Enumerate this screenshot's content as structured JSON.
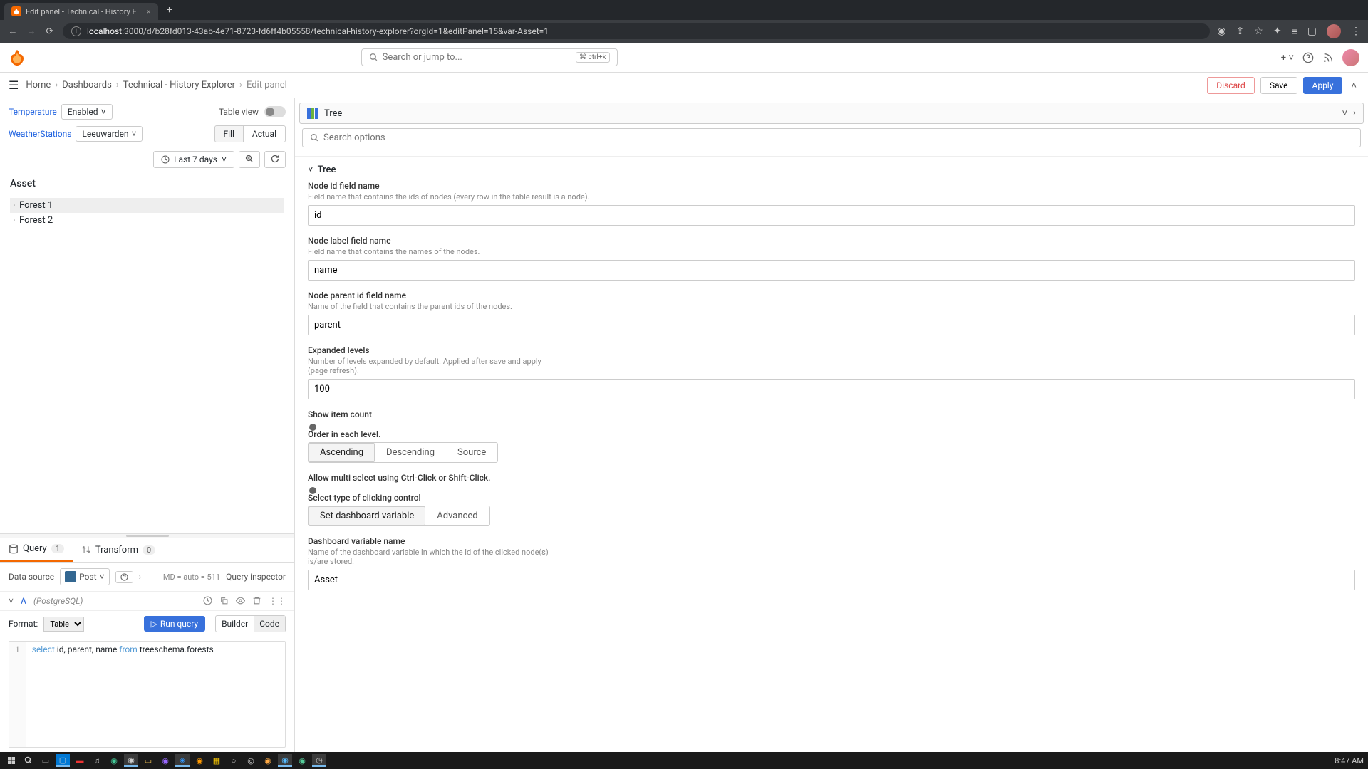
{
  "browser": {
    "tab_title": "Edit panel - Technical - History E",
    "url_host": "localhost",
    "url_path": ":3000/d/b28fd013-43ab-4e71-8723-fd6ff4b05558/technical-history-explorer?orgId=1&editPanel=15&var-Asset=1"
  },
  "search": {
    "placeholder": "Search or jump to...",
    "shortcut_label": "ctrl+k"
  },
  "breadcrumbs": {
    "items": [
      "Home",
      "Dashboards",
      "Technical - History Explorer",
      "Edit panel"
    ]
  },
  "actions": {
    "discard": "Discard",
    "save": "Save",
    "apply": "Apply"
  },
  "vars": {
    "temperature_label": "Temperature",
    "temperature_value": "Enabled",
    "stations_label": "WeatherStations",
    "stations_value": "Leeuwarden",
    "table_view": "Table view",
    "fill": "Fill",
    "actual": "Actual",
    "time_range": "Last 7 days"
  },
  "asset": {
    "title": "Asset",
    "items": [
      "Forest 1",
      "Forest 2"
    ]
  },
  "tabs": {
    "query": "Query",
    "query_count": "1",
    "transform": "Transform",
    "transform_count": "0"
  },
  "datasource": {
    "label": "Data source",
    "value": "Post",
    "md": "MD = auto = 511",
    "inspector": "Query inspector"
  },
  "query": {
    "letter": "A",
    "type": "(PostgreSQL)",
    "format_label": "Format:",
    "format_value": "Table",
    "run": "Run query",
    "builder": "Builder",
    "code": "Code",
    "sql_kw": "select",
    "sql_mid": " id, parent, name ",
    "sql_from": "from",
    "sql_tail": " treeschema.forests"
  },
  "viz": {
    "name": "Tree",
    "search_placeholder": "Search options"
  },
  "options": {
    "section": "Tree",
    "node_id": {
      "label": "Node id field name",
      "desc": "Field name that contains the ids of nodes (every row in the table result is a node).",
      "value": "id"
    },
    "node_label": {
      "label": "Node label field name",
      "desc": "Field name that contains the names of the nodes.",
      "value": "name"
    },
    "node_parent": {
      "label": "Node parent id field name",
      "desc": "Name of the field that contains the parent ids of the nodes.",
      "value": "parent"
    },
    "expanded": {
      "label": "Expanded levels",
      "desc": "Number of levels expanded by default. Applied after save and apply (page refresh).",
      "value": "100"
    },
    "show_count": {
      "label": "Show item count"
    },
    "order": {
      "label": "Order in each level.",
      "asc": "Ascending",
      "desc_opt": "Descending",
      "source": "Source"
    },
    "multi": {
      "label": "Allow multi select using Ctrl-Click or Shift-Click."
    },
    "click_type": {
      "label": "Select type of clicking control",
      "set_var": "Set dashboard variable",
      "advanced": "Advanced"
    },
    "dash_var": {
      "label": "Dashboard variable name",
      "desc": "Name of the dashboard variable in which the id of the clicked node(s) is/are stored.",
      "value": "Asset"
    }
  },
  "taskbar": {
    "time": "8:47 AM"
  }
}
